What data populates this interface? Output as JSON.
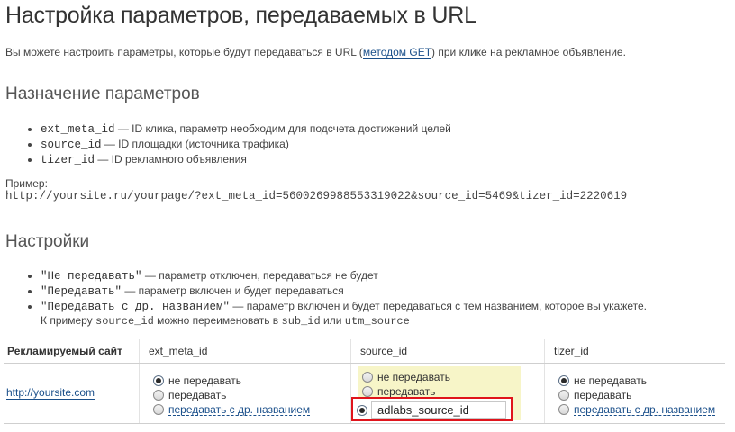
{
  "page": {
    "title": "Настройка параметров, передаваемых в URL",
    "intro_before": "Вы можете настроить параметры, которые будут передаваться в URL (",
    "intro_link": "методом GET",
    "intro_after": ") при клике на рекламное объявление."
  },
  "params_section": {
    "heading": "Назначение параметров",
    "items": [
      {
        "code": "ext_meta_id",
        "text": " — ID клика, параметр необходим для подсчета достижений целей"
      },
      {
        "code": "source_id",
        "text": " — ID площадки (источника трафика)"
      },
      {
        "code": "tizer_id",
        "text": " — ID рекламного объявления"
      }
    ],
    "example_label": "Пример:",
    "example_url": "http://yoursite.ru/yourpage/?ext_meta_id=5600269988553319022&source_id=5469&tizer_id=2220619"
  },
  "settings_section": {
    "heading": "Настройки",
    "items": [
      {
        "code": "\"Не передавать\"",
        "text": " — параметр отключен, передаваться не будет"
      },
      {
        "code": "\"Передавать\"",
        "text": " — параметр включен и будет передаваться"
      },
      {
        "code": "\"Передавать с др. названием\"",
        "text": " — параметр включен и будет передаваться с тем названием, которое вы укажете."
      }
    ],
    "note_prefix": "К примеру ",
    "note_code1": "source_id",
    "note_mid": " можно переименовать в ",
    "note_code2": "sub_id",
    "note_or": " или ",
    "note_code3": "utm_source"
  },
  "table": {
    "headers": [
      "Рекламируемый сайт",
      "ext_meta_id",
      "source_id",
      "tizer_id"
    ],
    "site": "http://yoursite.com",
    "options": [
      "не передавать",
      "передавать",
      "передавать с др. названием"
    ],
    "ext_meta_id_selected": "не передавать",
    "source_id_selected": "передавать с др. названием",
    "source_id_custom_name": "adlabs_source_id",
    "tizer_id_selected": "не передавать"
  },
  "colors": {
    "highlight_bg": "#f7f5c8",
    "focus_border": "#e0141c",
    "link": "#1a4f8a"
  }
}
